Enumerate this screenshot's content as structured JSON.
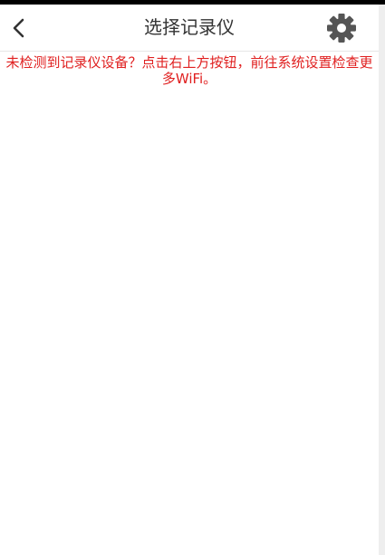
{
  "header": {
    "title": "选择记录仪",
    "back_icon": "chevron-left-icon",
    "settings_icon": "gear-icon"
  },
  "hint": {
    "text": "未检测到记录仪设备？点击右上方按钮，前往系统设置检查更多WiFi。",
    "color": "#e02020"
  },
  "devices": []
}
